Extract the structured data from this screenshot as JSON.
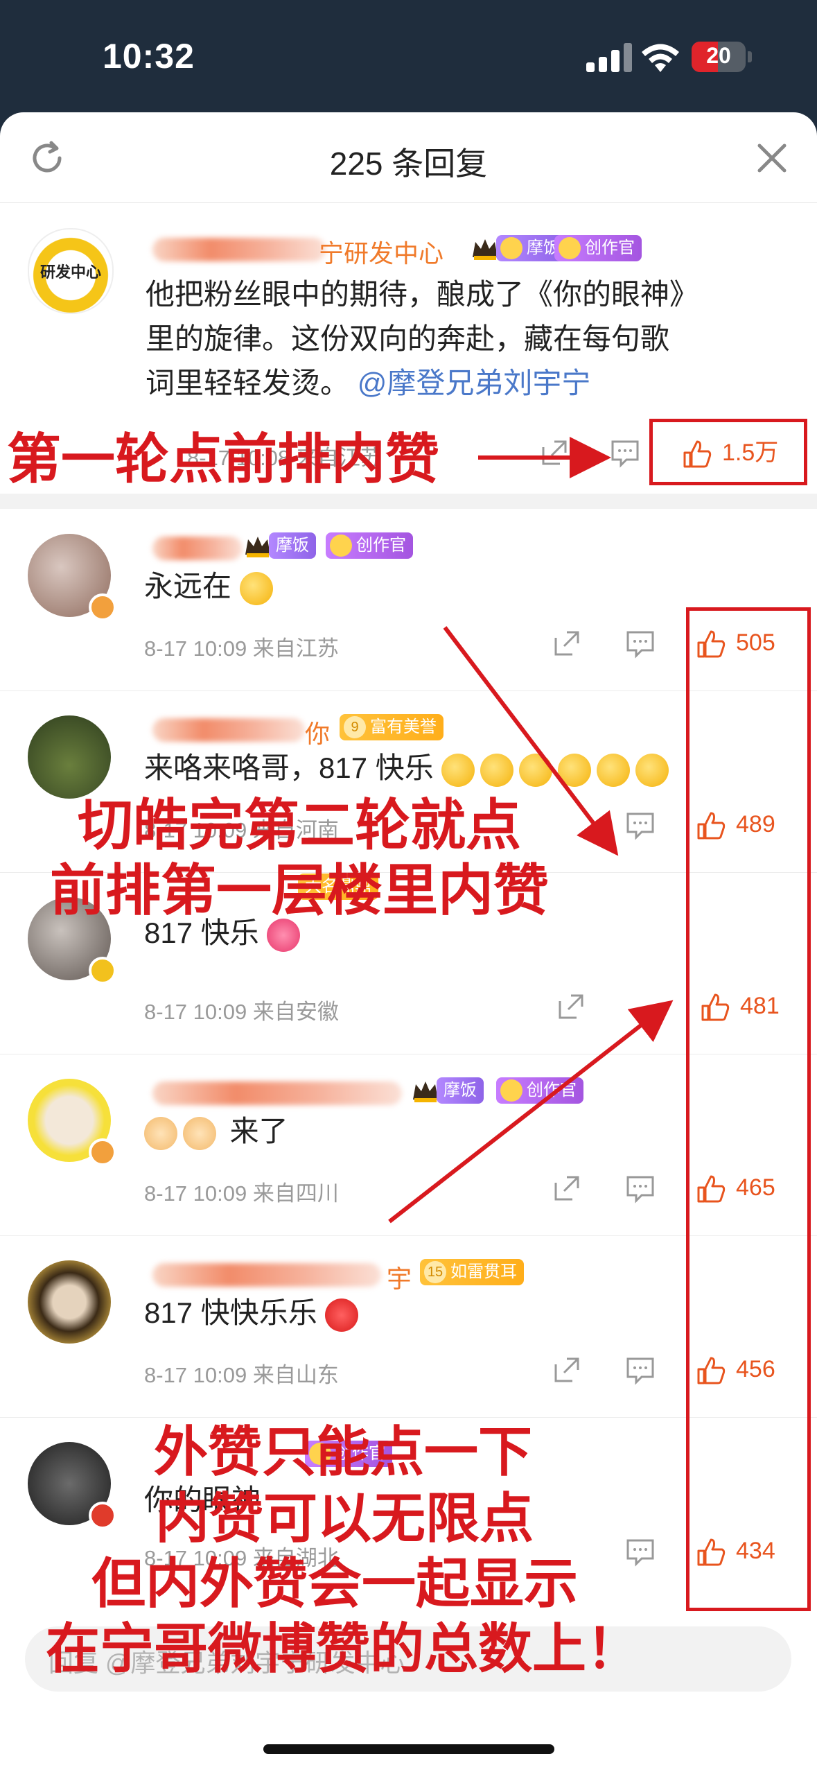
{
  "status_bar": {
    "time": "10:32",
    "battery": "20"
  },
  "sheet": {
    "title": "225 条回复"
  },
  "top_comment": {
    "name_suffix": "宁研发中心",
    "avatar_text": "研发中心",
    "badges": [
      "摩饭",
      "创作官"
    ],
    "text_line1": "他把粉丝眼中的期待，酿成了《你的眼神》",
    "text_line2": "里的旋律。这份双向的奔赴，藏在每句歌",
    "text_line3": "词里轻轻发烫。",
    "mention": "@摩登兄弟刘宇宁",
    "meta": "8-17 10:08 来自江苏",
    "likes": "1.5万"
  },
  "replies": [
    {
      "name_suffix": "",
      "badges": [
        "摩饭",
        "创作官"
      ],
      "text": "永远在",
      "meta": "8-17 10:09  来自江苏",
      "likes": "505"
    },
    {
      "name_suffix": "你",
      "badges": [
        "富有美誉"
      ],
      "text": "来咯来咯哥，817 快乐",
      "meta": "8-17 10:09  来自河南",
      "likes": "489"
    },
    {
      "name_suffix": "",
      "badges": [
        "大名鼎鼎"
      ],
      "text": "817 快乐",
      "meta": "8-17 10:09  来自安徽",
      "likes": "481"
    },
    {
      "name_suffix": "",
      "badges": [
        "摩饭",
        "创作官"
      ],
      "text": "来了",
      "meta": "8-17 10:09  来自四川",
      "likes": "465"
    },
    {
      "name_suffix": "宇",
      "badges": [
        "如雷贯耳"
      ],
      "text": "817 快快乐乐",
      "meta": "8-17 10:09  来自山东",
      "likes": "456"
    },
    {
      "name_suffix": "",
      "badges": [
        "创作官"
      ],
      "text": "你的眼神",
      "meta": "8-17 10:09  来自湖北",
      "likes": "434"
    }
  ],
  "level_badges": {
    "fuyou": "9",
    "ruleiguaner": "15"
  },
  "input": {
    "placeholder": "回复 @摩登兄弟刘宇宁研发中心"
  },
  "annotations": {
    "line1": "第一轮点前排内赞",
    "line2a": "切皓完第二轮就点",
    "line2b": "前排第一层楼里内赞",
    "line3a": "外赞只能点一下",
    "line3b": "内赞可以无限点",
    "line3c": "但内外赞会一起显示",
    "line3d": "在宁哥微博赞的总数上！"
  },
  "colors": {
    "annotation": "#d8191e",
    "like": "#e8541e",
    "status_bg": "#1f2d3d"
  }
}
